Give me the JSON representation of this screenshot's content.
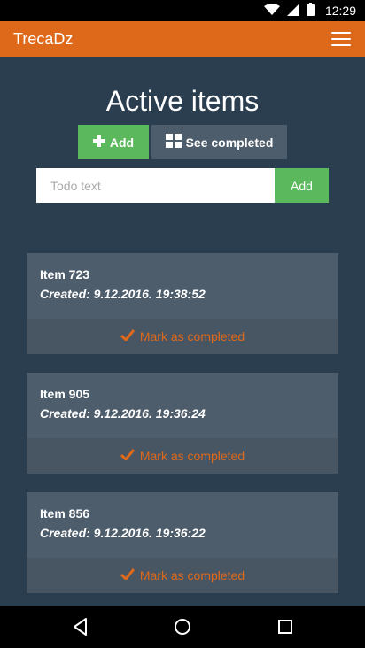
{
  "status_bar": {
    "time": "12:29",
    "icons": [
      "wifi-icon",
      "signal-icon",
      "battery-icon"
    ]
  },
  "app_bar": {
    "title": "TrecaDz",
    "menu_icon": "hamburger-menu-icon"
  },
  "page": {
    "title": "Active items"
  },
  "toolbar": {
    "add_label": "Add",
    "add_icon": "plus-icon",
    "see_completed_label": "See completed",
    "see_completed_icon": "grid-icon"
  },
  "todo_form": {
    "placeholder": "Todo text",
    "value": "",
    "add_label": "Add"
  },
  "items": [
    {
      "name": "Item 723",
      "created": "Created: 9.12.2016. 19:38:52",
      "action_label": "Mark as completed"
    },
    {
      "name": "Item 905",
      "created": "Created: 9.12.2016. 19:36:24",
      "action_label": "Mark as completed"
    },
    {
      "name": "Item 856",
      "created": "Created: 9.12.2016. 19:36:22",
      "action_label": "Mark as completed"
    }
  ],
  "colors": {
    "background": "#2b3e50",
    "accent": "#df691a",
    "success": "#5cb85c",
    "card": "#4e5d6c"
  },
  "nav_bar": {
    "buttons": [
      "back-icon",
      "home-icon",
      "recents-icon"
    ]
  }
}
